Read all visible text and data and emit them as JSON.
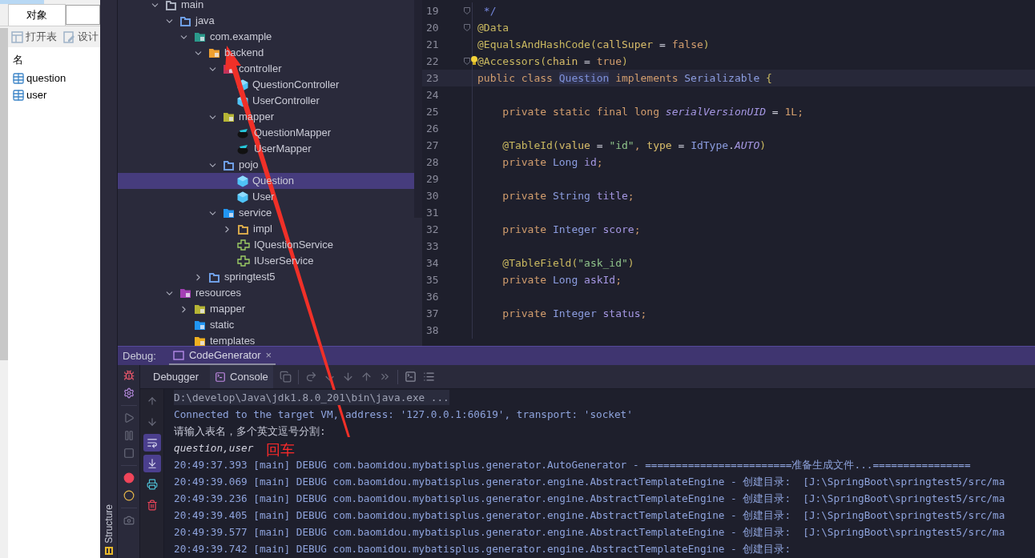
{
  "navicat": {
    "tabs": [
      {
        "label": "对象",
        "selected": true
      }
    ],
    "toolbar": [
      {
        "kind": "open",
        "label": "打开表"
      },
      {
        "kind": "design",
        "label": "设计"
      }
    ],
    "column": "名",
    "tables": [
      "question",
      "user"
    ]
  },
  "side_strip": {
    "label": "Structure"
  },
  "project_tree": [
    {
      "label": "main",
      "kind": "folder",
      "color": "#aab0be",
      "expanded": true,
      "selected": false,
      "children": [
        {
          "label": "java",
          "kind": "folder",
          "color": "#6f9fe6",
          "expanded": true,
          "selected": false,
          "children": [
            {
              "label": "com.example",
              "kind": "package",
              "color": "#2b9a8c",
              "expanded": true,
              "selected": false,
              "children": [
                {
                  "label": "backend",
                  "kind": "package",
                  "color": "#f0a030",
                  "expanded": true,
                  "selected": false,
                  "children": [
                    {
                      "label": "controller",
                      "kind": "package",
                      "color": "#c2325a",
                      "expanded": true,
                      "selected": false,
                      "children": [
                        {
                          "label": "QuestionController",
                          "kind": "class",
                          "selected": false
                        },
                        {
                          "label": "UserController",
                          "kind": "class",
                          "selected": false
                        }
                      ]
                    },
                    {
                      "label": "mapper",
                      "kind": "package",
                      "color": "#b6b535",
                      "expanded": true,
                      "selected": false,
                      "children": [
                        {
                          "label": "QuestionMapper",
                          "kind": "mapper",
                          "selected": false
                        },
                        {
                          "label": "UserMapper",
                          "kind": "mapper",
                          "selected": false
                        }
                      ]
                    },
                    {
                      "label": "pojo",
                      "kind": "folder",
                      "color": "#6f9fe6",
                      "expanded": true,
                      "selected": false,
                      "children": [
                        {
                          "label": "Question",
                          "kind": "class",
                          "selected": true
                        },
                        {
                          "label": "User",
                          "kind": "class",
                          "selected": false
                        }
                      ]
                    },
                    {
                      "label": "service",
                      "kind": "package",
                      "color": "#2196f3",
                      "expanded": true,
                      "selected": false,
                      "children": [
                        {
                          "label": "impl",
                          "kind": "folder",
                          "color": "#d6a84b",
                          "expanded": false,
                          "selected": false
                        },
                        {
                          "label": "IQuestionService",
                          "kind": "interface",
                          "selected": false
                        },
                        {
                          "label": "IUserService",
                          "kind": "interface",
                          "selected": false
                        }
                      ]
                    }
                  ]
                },
                {
                  "label": "springtest5",
                  "kind": "folder",
                  "color": "#6f9fe6",
                  "expanded": false,
                  "selected": false
                }
              ]
            }
          ]
        },
        {
          "label": "resources",
          "kind": "package",
          "color": "#a43fb5",
          "expanded": true,
          "selected": false,
          "children": [
            {
              "label": "mapper",
              "kind": "package",
              "color": "#b6b535",
              "expanded": false,
              "selected": false
            },
            {
              "label": "static",
              "kind": "package",
              "color": "#2196f3",
              "selected": false
            },
            {
              "label": "templates",
              "kind": "package",
              "color": "#f0b020",
              "selected": false
            }
          ]
        }
      ]
    }
  ],
  "editor": {
    "lines": [
      {
        "number": "19",
        "fold": true,
        "current": false,
        "bulb": false,
        "tokens": [
          {
            "text": " */",
            "kind": "comment"
          }
        ]
      },
      {
        "number": "20",
        "fold": true,
        "current": false,
        "bulb": false,
        "tokens": [
          {
            "text": "@Data",
            "kind": "annotation"
          }
        ]
      },
      {
        "number": "21",
        "fold": false,
        "current": false,
        "bulb": false,
        "tokens": [
          {
            "text": "@EqualsAndHashCode(",
            "kind": "annotation"
          },
          {
            "text": "callSuper",
            "kind": "param"
          },
          {
            "text": " = ",
            "kind": "plain"
          },
          {
            "text": "false",
            "kind": "keyword"
          },
          {
            "text": ")",
            "kind": "annotation"
          }
        ]
      },
      {
        "number": "22",
        "fold": true,
        "current": false,
        "bulb": true,
        "tokens": [
          {
            "text": "@Accessors(",
            "kind": "annotation"
          },
          {
            "text": "chain",
            "kind": "param"
          },
          {
            "text": " = ",
            "kind": "plain"
          },
          {
            "text": "true",
            "kind": "keyword"
          },
          {
            "text": ")",
            "kind": "annotation"
          }
        ]
      },
      {
        "number": "23",
        "fold": false,
        "current": true,
        "bulb": false,
        "tokens": [
          {
            "text": "public class ",
            "kind": "keyword"
          },
          {
            "text": "Question",
            "kind": "classname"
          },
          {
            "text": " implements ",
            "kind": "keyword"
          },
          {
            "text": "Serializable",
            "kind": "type"
          },
          {
            "text": " {",
            "kind": "annotation"
          }
        ]
      },
      {
        "number": "24",
        "fold": false,
        "current": false,
        "bulb": false
      },
      {
        "number": "25",
        "fold": false,
        "current": false,
        "bulb": false,
        "tokens": [
          {
            "text": "    private static final long ",
            "kind": "keyword"
          },
          {
            "text": "serialVersionUID",
            "kind": "constant"
          },
          {
            "text": " = ",
            "kind": "plain"
          },
          {
            "text": "1L",
            "kind": "number"
          },
          {
            "text": ";",
            "kind": "keyword"
          }
        ]
      },
      {
        "number": "26",
        "fold": false,
        "current": false,
        "bulb": false
      },
      {
        "number": "27",
        "fold": false,
        "current": false,
        "bulb": false,
        "tokens": [
          {
            "text": "    @TableId(",
            "kind": "annotation"
          },
          {
            "text": "value",
            "kind": "param"
          },
          {
            "text": " = ",
            "kind": "plain"
          },
          {
            "text": "\"id\"",
            "kind": "string"
          },
          {
            "text": ", ",
            "kind": "keyword"
          },
          {
            "text": "type",
            "kind": "param"
          },
          {
            "text": " = ",
            "kind": "plain"
          },
          {
            "text": "IdType",
            "kind": "type"
          },
          {
            "text": ".",
            "kind": "plain"
          },
          {
            "text": "AUTO",
            "kind": "constant"
          },
          {
            "text": ")",
            "kind": "annotation"
          }
        ]
      },
      {
        "number": "28",
        "fold": false,
        "current": false,
        "bulb": false,
        "tokens": [
          {
            "text": "    private ",
            "kind": "keyword"
          },
          {
            "text": "Long",
            "kind": "type"
          },
          {
            "text": " id",
            "kind": "field"
          },
          {
            "text": ";",
            "kind": "keyword"
          }
        ]
      },
      {
        "number": "29",
        "fold": false,
        "current": false,
        "bulb": false
      },
      {
        "number": "30",
        "fold": false,
        "current": false,
        "bulb": false,
        "tokens": [
          {
            "text": "    private ",
            "kind": "keyword"
          },
          {
            "text": "String",
            "kind": "type"
          },
          {
            "text": " title",
            "kind": "field"
          },
          {
            "text": ";",
            "kind": "keyword"
          }
        ]
      },
      {
        "number": "31",
        "fold": false,
        "current": false,
        "bulb": false
      },
      {
        "number": "32",
        "fold": false,
        "current": false,
        "bulb": false,
        "tokens": [
          {
            "text": "    private ",
            "kind": "keyword"
          },
          {
            "text": "Integer",
            "kind": "type"
          },
          {
            "text": " score",
            "kind": "field"
          },
          {
            "text": ";",
            "kind": "keyword"
          }
        ]
      },
      {
        "number": "33",
        "fold": false,
        "current": false,
        "bulb": false
      },
      {
        "number": "34",
        "fold": false,
        "current": false,
        "bulb": false,
        "tokens": [
          {
            "text": "    @TableField(",
            "kind": "annotation"
          },
          {
            "text": "\"ask_id\"",
            "kind": "string"
          },
          {
            "text": ")",
            "kind": "annotation"
          }
        ]
      },
      {
        "number": "35",
        "fold": false,
        "current": false,
        "bulb": false,
        "tokens": [
          {
            "text": "    private ",
            "kind": "keyword"
          },
          {
            "text": "Long",
            "kind": "type"
          },
          {
            "text": " askId",
            "kind": "field"
          },
          {
            "text": ";",
            "kind": "keyword"
          }
        ]
      },
      {
        "number": "36",
        "fold": false,
        "current": false,
        "bulb": false
      },
      {
        "number": "37",
        "fold": false,
        "current": false,
        "bulb": false,
        "tokens": [
          {
            "text": "    private ",
            "kind": "keyword"
          },
          {
            "text": "Integer",
            "kind": "type"
          },
          {
            "text": " status",
            "kind": "field"
          },
          {
            "text": ";",
            "kind": "keyword"
          }
        ]
      },
      {
        "number": "38",
        "fold": false,
        "current": false,
        "bulb": false
      }
    ]
  },
  "debug": {
    "title": "Debug:",
    "tabs": [
      {
        "label": "CodeGenerator",
        "close": "×",
        "selected": true
      }
    ],
    "sub_tabs": [
      {
        "label": "Debugger",
        "selected": false
      },
      {
        "label": "Console",
        "selected": true
      }
    ],
    "toolbar": [
      {
        "kind": "layers"
      },
      {
        "kind": "sep"
      },
      {
        "kind": "step-over"
      },
      {
        "kind": "step-into"
      },
      {
        "kind": "force-step-into"
      },
      {
        "kind": "step-out"
      },
      {
        "kind": "run-to-cursor"
      },
      {
        "kind": "sep"
      },
      {
        "kind": "terminal"
      },
      {
        "kind": "list"
      }
    ],
    "left_tools": [
      {
        "kind": "bug"
      },
      {
        "kind": "settings"
      },
      {
        "kind": "sep"
      },
      {
        "kind": "resume"
      },
      {
        "kind": "pause"
      },
      {
        "kind": "stop"
      },
      {
        "kind": "sep"
      },
      {
        "kind": "breakpoints"
      },
      {
        "kind": "mute"
      },
      {
        "kind": "sep"
      },
      {
        "kind": "camera"
      }
    ],
    "console_tools": [
      {
        "kind": "up",
        "on": false
      },
      {
        "kind": "down",
        "on": false
      },
      {
        "kind": "wrap",
        "on": true
      },
      {
        "kind": "scroll-end",
        "on": true
      },
      {
        "kind": "print",
        "on": false
      },
      {
        "kind": "clear",
        "on": false
      }
    ]
  },
  "console": {
    "lines": [
      {
        "kind": "command",
        "text": "D:\\develop\\Java\\jdk1.8.0_201\\bin\\java.exe ..."
      },
      {
        "kind": "info",
        "text": "Connected to the target VM, address: '127.0.0.1:60619', transport: 'socket'"
      },
      {
        "kind": "prompt",
        "text": "请输入表名，多个英文逗号分割:"
      },
      {
        "kind": "input",
        "text": "question,user"
      },
      {
        "kind": "log",
        "text": "20:49:37.393 [main] DEBUG com.baomidou.mybatisplus.generator.AutoGenerator - ========================准备生成文件...================"
      },
      {
        "kind": "log",
        "text": "20:49:39.069 [main] DEBUG com.baomidou.mybatisplus.generator.engine.AbstractTemplateEngine - 创建目录:  [J:\\SpringBoot\\springtest5/src/ma"
      },
      {
        "kind": "log",
        "text": "20:49:39.236 [main] DEBUG com.baomidou.mybatisplus.generator.engine.AbstractTemplateEngine - 创建目录:  [J:\\SpringBoot\\springtest5/src/ma"
      },
      {
        "kind": "log",
        "text": "20:49:39.405 [main] DEBUG com.baomidou.mybatisplus.generator.engine.AbstractTemplateEngine - 创建目录:  [J:\\SpringBoot\\springtest5/src/ma"
      },
      {
        "kind": "log",
        "text": "20:49:39.577 [main] DEBUG com.baomidou.mybatisplus.generator.engine.AbstractTemplateEngine - 创建目录:  [J:\\SpringBoot\\springtest5/src/ma"
      },
      {
        "kind": "log",
        "text": "20:49:39.742 [main] DEBUG com.baomidou.mybatisplus.generator.engine.AbstractTemplateEngine - 创建目录:"
      }
    ]
  },
  "annotation": {
    "label": "回车"
  }
}
